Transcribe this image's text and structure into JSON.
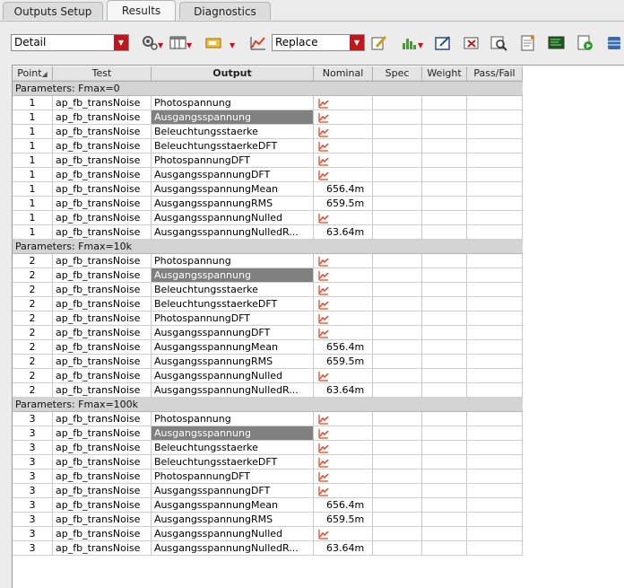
{
  "tabs": [
    {
      "label": "Outputs Setup",
      "active": false
    },
    {
      "label": "Results",
      "active": true
    },
    {
      "label": "Diagnostics",
      "active": false
    }
  ],
  "toolbar": {
    "view_select": "Detail",
    "mode_select": "Replace",
    "icons": [
      "gear-icon",
      "table-columns-icon",
      "results-view-icon",
      "plot-icon",
      "edit-icon",
      "histogram-icon",
      "annotate-icon",
      "delete-results-icon",
      "zoom-results-icon",
      "report-icon",
      "terminal-icon",
      "run-icon",
      "database-icon"
    ]
  },
  "table": {
    "headers": {
      "point": "Point",
      "test": "Test",
      "output": "Output",
      "nominal": "Nominal",
      "spec": "Spec",
      "weight": "Weight",
      "passfail": "Pass/Fail"
    },
    "groups": [
      {
        "label": "Parameters: Fmax=0",
        "point": "1",
        "rows": [
          {
            "test": "ap_fb_transNoise",
            "output": "Photospannung",
            "nominal": "",
            "plot": true,
            "selected": false
          },
          {
            "test": "ap_fb_transNoise",
            "output": "Ausgangsspannung",
            "nominal": "",
            "plot": true,
            "selected": true
          },
          {
            "test": "ap_fb_transNoise",
            "output": "Beleuchtungsstaerke",
            "nominal": "",
            "plot": true,
            "selected": false
          },
          {
            "test": "ap_fb_transNoise",
            "output": "BeleuchtungsstaerkeDFT",
            "nominal": "",
            "plot": true,
            "selected": false
          },
          {
            "test": "ap_fb_transNoise",
            "output": "PhotospannungDFT",
            "nominal": "",
            "plot": true,
            "selected": false
          },
          {
            "test": "ap_fb_transNoise",
            "output": "AusgangsspannungDFT",
            "nominal": "",
            "plot": true,
            "selected": false
          },
          {
            "test": "ap_fb_transNoise",
            "output": "AusgangsspannungMean",
            "nominal": "656.4m",
            "plot": false,
            "selected": false
          },
          {
            "test": "ap_fb_transNoise",
            "output": "AusgangsspannungRMS",
            "nominal": "659.5m",
            "plot": false,
            "selected": false
          },
          {
            "test": "ap_fb_transNoise",
            "output": "AusgangsspannungNulled",
            "nominal": "",
            "plot": true,
            "selected": false
          },
          {
            "test": "ap_fb_transNoise",
            "output": "AusgangsspannungNulledR...",
            "nominal": "63.64m",
            "plot": false,
            "selected": false
          }
        ]
      },
      {
        "label": "Parameters: Fmax=10k",
        "point": "2",
        "rows": [
          {
            "test": "ap_fb_transNoise",
            "output": "Photospannung",
            "nominal": "",
            "plot": true,
            "selected": false
          },
          {
            "test": "ap_fb_transNoise",
            "output": "Ausgangsspannung",
            "nominal": "",
            "plot": true,
            "selected": true
          },
          {
            "test": "ap_fb_transNoise",
            "output": "Beleuchtungsstaerke",
            "nominal": "",
            "plot": true,
            "selected": false
          },
          {
            "test": "ap_fb_transNoise",
            "output": "BeleuchtungsstaerkeDFT",
            "nominal": "",
            "plot": true,
            "selected": false
          },
          {
            "test": "ap_fb_transNoise",
            "output": "PhotospannungDFT",
            "nominal": "",
            "plot": true,
            "selected": false
          },
          {
            "test": "ap_fb_transNoise",
            "output": "AusgangsspannungDFT",
            "nominal": "",
            "plot": true,
            "selected": false
          },
          {
            "test": "ap_fb_transNoise",
            "output": "AusgangsspannungMean",
            "nominal": "656.4m",
            "plot": false,
            "selected": false
          },
          {
            "test": "ap_fb_transNoise",
            "output": "AusgangsspannungRMS",
            "nominal": "659.5m",
            "plot": false,
            "selected": false
          },
          {
            "test": "ap_fb_transNoise",
            "output": "AusgangsspannungNulled",
            "nominal": "",
            "plot": true,
            "selected": false
          },
          {
            "test": "ap_fb_transNoise",
            "output": "AusgangsspannungNulledR...",
            "nominal": "63.64m",
            "plot": false,
            "selected": false
          }
        ]
      },
      {
        "label": "Parameters: Fmax=100k",
        "point": "3",
        "rows": [
          {
            "test": "ap_fb_transNoise",
            "output": "Photospannung",
            "nominal": "",
            "plot": true,
            "selected": false
          },
          {
            "test": "ap_fb_transNoise",
            "output": "Ausgangsspannung",
            "nominal": "",
            "plot": true,
            "selected": true
          },
          {
            "test": "ap_fb_transNoise",
            "output": "Beleuchtungsstaerke",
            "nominal": "",
            "plot": true,
            "selected": false
          },
          {
            "test": "ap_fb_transNoise",
            "output": "BeleuchtungsstaerkeDFT",
            "nominal": "",
            "plot": true,
            "selected": false
          },
          {
            "test": "ap_fb_transNoise",
            "output": "PhotospannungDFT",
            "nominal": "",
            "plot": true,
            "selected": false
          },
          {
            "test": "ap_fb_transNoise",
            "output": "AusgangsspannungDFT",
            "nominal": "",
            "plot": true,
            "selected": false
          },
          {
            "test": "ap_fb_transNoise",
            "output": "AusgangsspannungMean",
            "nominal": "656.4m",
            "plot": false,
            "selected": false
          },
          {
            "test": "ap_fb_transNoise",
            "output": "AusgangsspannungRMS",
            "nominal": "659.5m",
            "plot": false,
            "selected": false
          },
          {
            "test": "ap_fb_transNoise",
            "output": "AusgangsspannungNulled",
            "nominal": "",
            "plot": true,
            "selected": false
          },
          {
            "test": "ap_fb_transNoise",
            "output": "AusgangsspannungNulledR...",
            "nominal": "63.64m",
            "plot": false,
            "selected": false
          }
        ]
      }
    ]
  },
  "colors": {
    "accent": "#c0161c",
    "selected_row": "#808080",
    "group_bg": "#d4d4d4",
    "plot_icon": "#d9421b"
  }
}
